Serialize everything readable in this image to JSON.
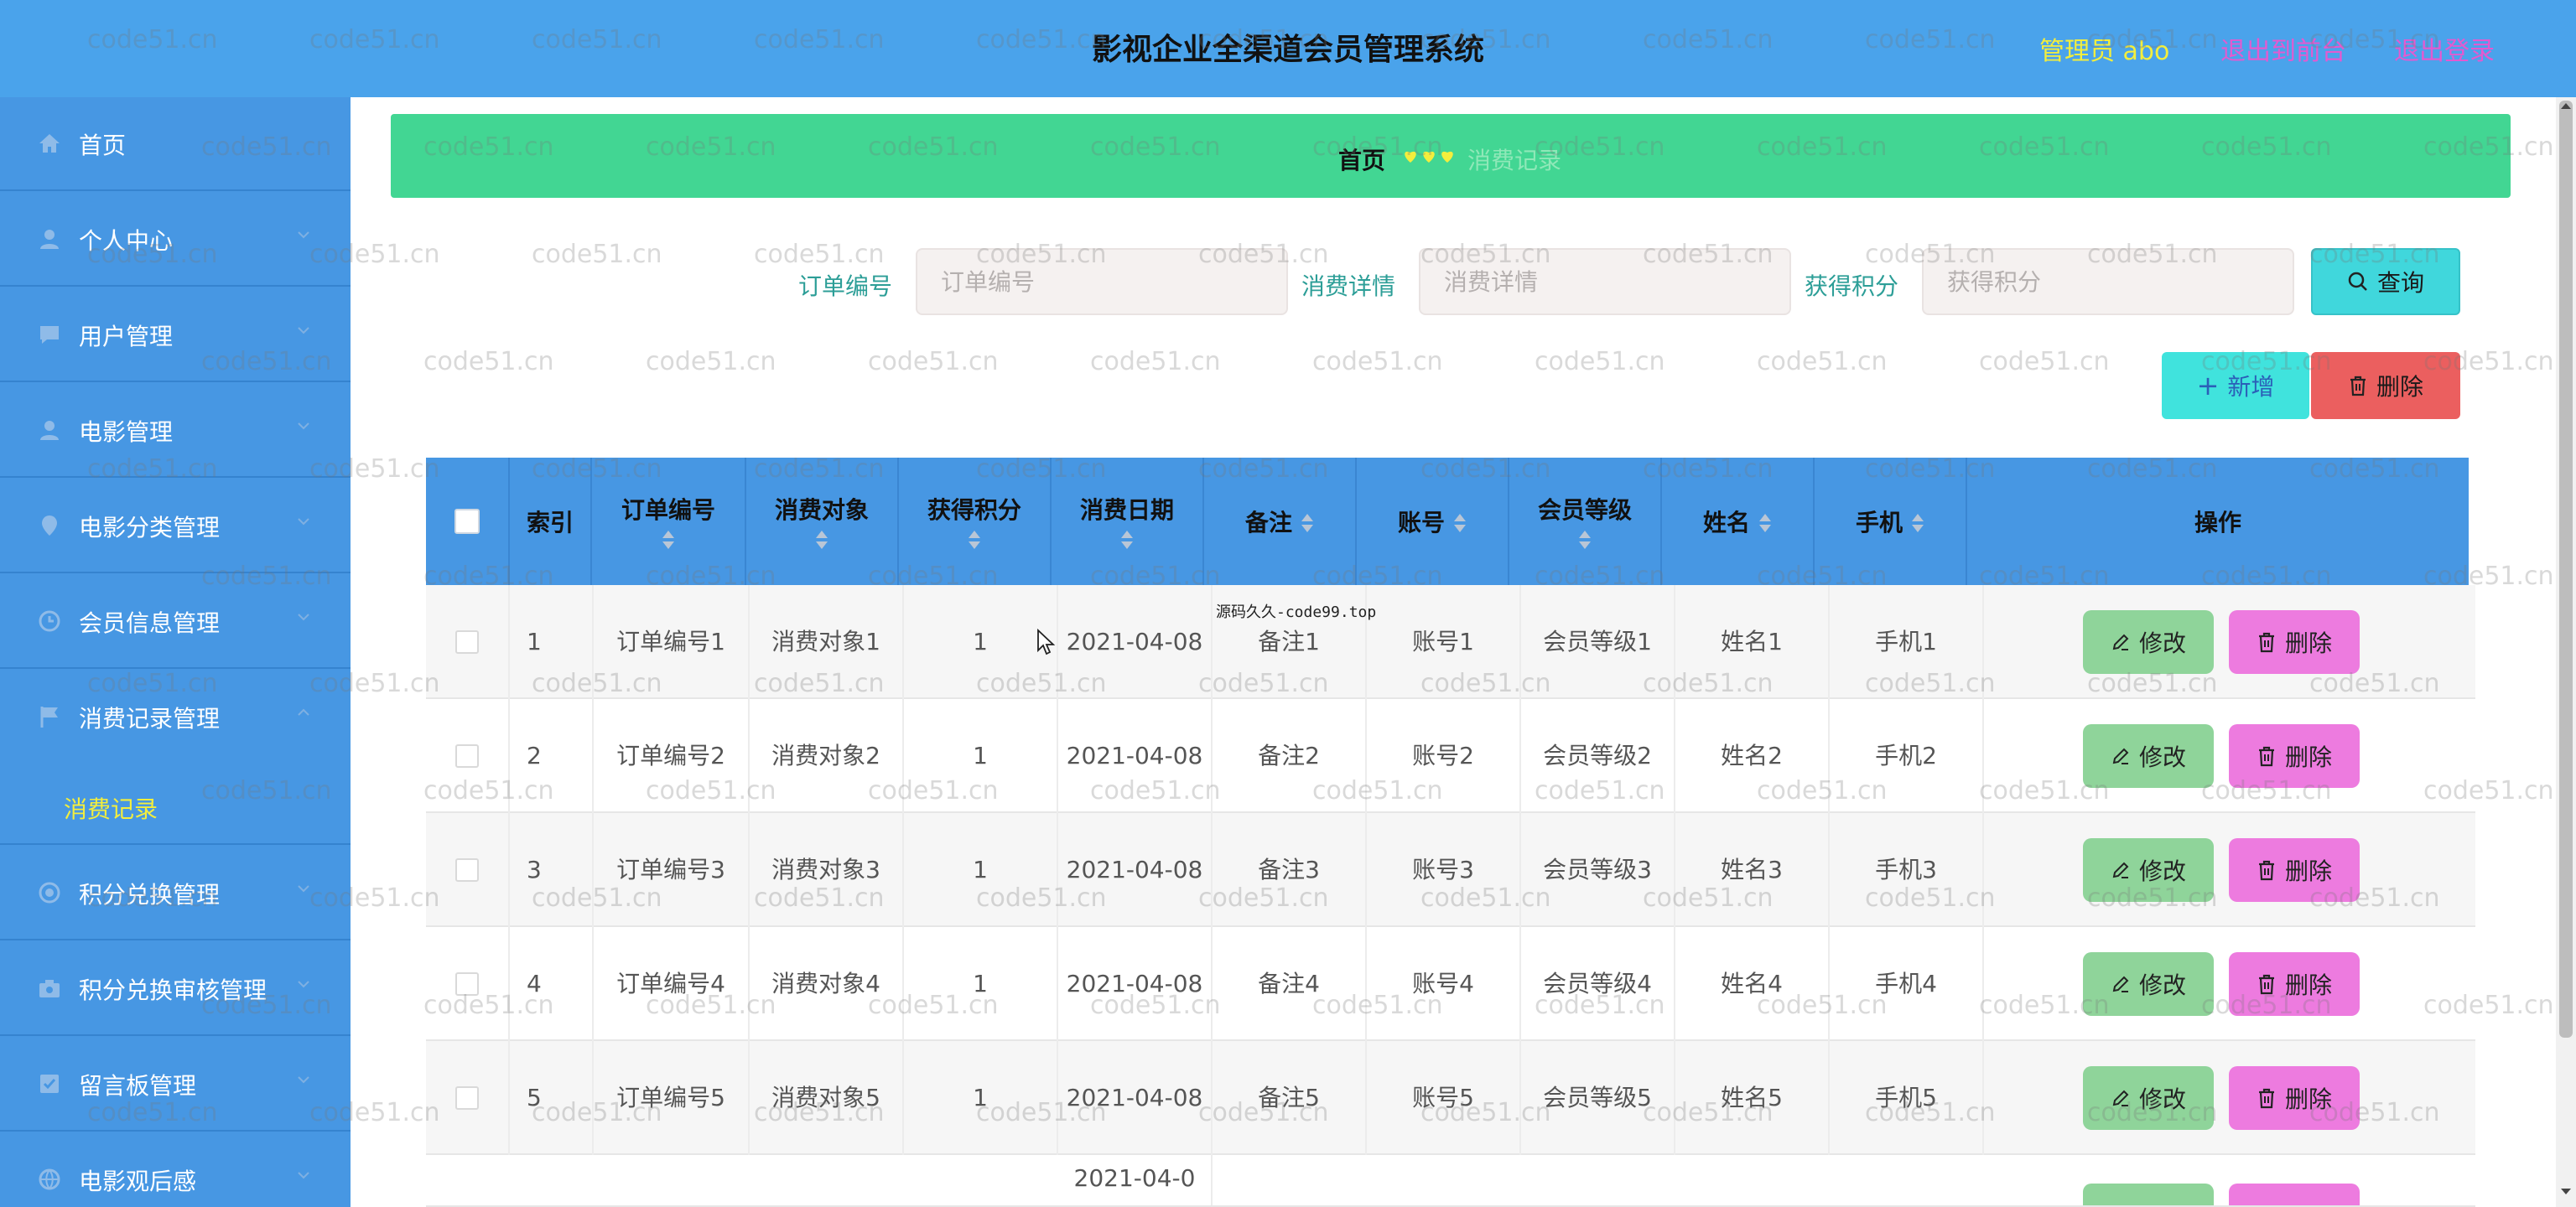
{
  "header": {
    "title": "影视企业全渠道会员管理系统",
    "user_label": "管理员 abo",
    "front_link": "退出到前台",
    "logout_link": "退出登录"
  },
  "sidebar": {
    "items": [
      {
        "label": "首页",
        "icon": "home-icon"
      },
      {
        "label": "个人中心",
        "icon": "user-icon"
      },
      {
        "label": "用户管理",
        "icon": "chat-icon"
      },
      {
        "label": "电影管理",
        "icon": "user-icon"
      },
      {
        "label": "电影分类管理",
        "icon": "location-icon"
      },
      {
        "label": "会员信息管理",
        "icon": "clock-icon"
      },
      {
        "label": "消费记录管理",
        "icon": "flag-icon"
      },
      {
        "label": "积分兑换管理",
        "icon": "circle-icon"
      },
      {
        "label": "积分兑换审核管理",
        "icon": "camera-icon"
      },
      {
        "label": "留言板管理",
        "icon": "checkbox-icon"
      },
      {
        "label": "电影观后感",
        "icon": "globe-icon"
      }
    ],
    "active_sub": "消费记录"
  },
  "breadcrumb": {
    "home": "首页",
    "current": "消费记录"
  },
  "search": {
    "fields": [
      {
        "label": "订单编号",
        "placeholder": "订单编号"
      },
      {
        "label": "消费详情",
        "placeholder": "消费详情"
      },
      {
        "label": "获得积分",
        "placeholder": "获得积分"
      }
    ],
    "query_label": "查询"
  },
  "toolbar": {
    "add_label": "新增",
    "delete_label": "删除"
  },
  "table": {
    "columns": [
      "索引",
      "订单编号",
      "消费对象",
      "获得积分",
      "消费日期",
      "备注",
      "账号",
      "会员等级",
      "姓名",
      "手机",
      "操作"
    ],
    "rows": [
      {
        "index": "1",
        "order_no": "订单编号1",
        "target": "消费对象1",
        "points": "1",
        "date": "2021-04-08",
        "note": "备注1",
        "account": "账号1",
        "level": "会员等级1",
        "name": "姓名1",
        "phone": "手机1"
      },
      {
        "index": "2",
        "order_no": "订单编号2",
        "target": "消费对象2",
        "points": "1",
        "date": "2021-04-08",
        "note": "备注2",
        "account": "账号2",
        "level": "会员等级2",
        "name": "姓名2",
        "phone": "手机2"
      },
      {
        "index": "3",
        "order_no": "订单编号3",
        "target": "消费对象3",
        "points": "1",
        "date": "2021-04-08",
        "note": "备注3",
        "account": "账号3",
        "level": "会员等级3",
        "name": "姓名3",
        "phone": "手机3"
      },
      {
        "index": "4",
        "order_no": "订单编号4",
        "target": "消费对象4",
        "points": "1",
        "date": "2021-04-08",
        "note": "备注4",
        "account": "账号4",
        "level": "会员等级4",
        "name": "姓名4",
        "phone": "手机4"
      },
      {
        "index": "5",
        "order_no": "订单编号5",
        "target": "消费对象5",
        "points": "1",
        "date": "2021-04-08",
        "note": "备注5",
        "account": "账号5",
        "level": "会员等级5",
        "name": "姓名5",
        "phone": "手机5"
      },
      {
        "index": "",
        "order_no": "",
        "target": "",
        "points": "",
        "date": "2021-04-0",
        "note": "",
        "account": "",
        "level": "",
        "name": "",
        "phone": ""
      }
    ],
    "edit_label": "修改",
    "delete_label": "删除"
  },
  "overlay_note": "源码久久-code99.top",
  "watermark": "code51.cn",
  "colors": {
    "topbar": "#4aa3eb",
    "sidebar": "#4797e3",
    "breadcrumb": "#42d693",
    "accent_yellow": "#f3ee3d",
    "accent_pink": "#e35ad0",
    "edit_button": "#8fd49a",
    "delete_button": "#ed7bdf"
  }
}
